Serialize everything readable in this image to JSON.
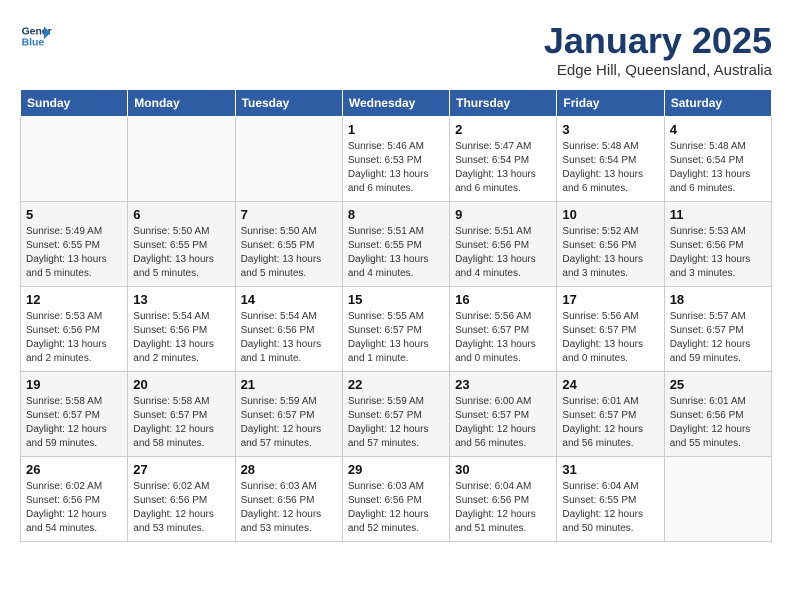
{
  "header": {
    "logo_line1": "General",
    "logo_line2": "Blue",
    "month": "January 2025",
    "location": "Edge Hill, Queensland, Australia"
  },
  "days_of_week": [
    "Sunday",
    "Monday",
    "Tuesday",
    "Wednesday",
    "Thursday",
    "Friday",
    "Saturday"
  ],
  "weeks": [
    [
      {
        "num": "",
        "info": ""
      },
      {
        "num": "",
        "info": ""
      },
      {
        "num": "",
        "info": ""
      },
      {
        "num": "1",
        "info": "Sunrise: 5:46 AM\nSunset: 6:53 PM\nDaylight: 13 hours\nand 6 minutes."
      },
      {
        "num": "2",
        "info": "Sunrise: 5:47 AM\nSunset: 6:54 PM\nDaylight: 13 hours\nand 6 minutes."
      },
      {
        "num": "3",
        "info": "Sunrise: 5:48 AM\nSunset: 6:54 PM\nDaylight: 13 hours\nand 6 minutes."
      },
      {
        "num": "4",
        "info": "Sunrise: 5:48 AM\nSunset: 6:54 PM\nDaylight: 13 hours\nand 6 minutes."
      }
    ],
    [
      {
        "num": "5",
        "info": "Sunrise: 5:49 AM\nSunset: 6:55 PM\nDaylight: 13 hours\nand 5 minutes."
      },
      {
        "num": "6",
        "info": "Sunrise: 5:50 AM\nSunset: 6:55 PM\nDaylight: 13 hours\nand 5 minutes."
      },
      {
        "num": "7",
        "info": "Sunrise: 5:50 AM\nSunset: 6:55 PM\nDaylight: 13 hours\nand 5 minutes."
      },
      {
        "num": "8",
        "info": "Sunrise: 5:51 AM\nSunset: 6:55 PM\nDaylight: 13 hours\nand 4 minutes."
      },
      {
        "num": "9",
        "info": "Sunrise: 5:51 AM\nSunset: 6:56 PM\nDaylight: 13 hours\nand 4 minutes."
      },
      {
        "num": "10",
        "info": "Sunrise: 5:52 AM\nSunset: 6:56 PM\nDaylight: 13 hours\nand 3 minutes."
      },
      {
        "num": "11",
        "info": "Sunrise: 5:53 AM\nSunset: 6:56 PM\nDaylight: 13 hours\nand 3 minutes."
      }
    ],
    [
      {
        "num": "12",
        "info": "Sunrise: 5:53 AM\nSunset: 6:56 PM\nDaylight: 13 hours\nand 2 minutes."
      },
      {
        "num": "13",
        "info": "Sunrise: 5:54 AM\nSunset: 6:56 PM\nDaylight: 13 hours\nand 2 minutes."
      },
      {
        "num": "14",
        "info": "Sunrise: 5:54 AM\nSunset: 6:56 PM\nDaylight: 13 hours\nand 1 minute."
      },
      {
        "num": "15",
        "info": "Sunrise: 5:55 AM\nSunset: 6:57 PM\nDaylight: 13 hours\nand 1 minute."
      },
      {
        "num": "16",
        "info": "Sunrise: 5:56 AM\nSunset: 6:57 PM\nDaylight: 13 hours\nand 0 minutes."
      },
      {
        "num": "17",
        "info": "Sunrise: 5:56 AM\nSunset: 6:57 PM\nDaylight: 13 hours\nand 0 minutes."
      },
      {
        "num": "18",
        "info": "Sunrise: 5:57 AM\nSunset: 6:57 PM\nDaylight: 12 hours\nand 59 minutes."
      }
    ],
    [
      {
        "num": "19",
        "info": "Sunrise: 5:58 AM\nSunset: 6:57 PM\nDaylight: 12 hours\nand 59 minutes."
      },
      {
        "num": "20",
        "info": "Sunrise: 5:58 AM\nSunset: 6:57 PM\nDaylight: 12 hours\nand 58 minutes."
      },
      {
        "num": "21",
        "info": "Sunrise: 5:59 AM\nSunset: 6:57 PM\nDaylight: 12 hours\nand 57 minutes."
      },
      {
        "num": "22",
        "info": "Sunrise: 5:59 AM\nSunset: 6:57 PM\nDaylight: 12 hours\nand 57 minutes."
      },
      {
        "num": "23",
        "info": "Sunrise: 6:00 AM\nSunset: 6:57 PM\nDaylight: 12 hours\nand 56 minutes."
      },
      {
        "num": "24",
        "info": "Sunrise: 6:01 AM\nSunset: 6:57 PM\nDaylight: 12 hours\nand 56 minutes."
      },
      {
        "num": "25",
        "info": "Sunrise: 6:01 AM\nSunset: 6:56 PM\nDaylight: 12 hours\nand 55 minutes."
      }
    ],
    [
      {
        "num": "26",
        "info": "Sunrise: 6:02 AM\nSunset: 6:56 PM\nDaylight: 12 hours\nand 54 minutes."
      },
      {
        "num": "27",
        "info": "Sunrise: 6:02 AM\nSunset: 6:56 PM\nDaylight: 12 hours\nand 53 minutes."
      },
      {
        "num": "28",
        "info": "Sunrise: 6:03 AM\nSunset: 6:56 PM\nDaylight: 12 hours\nand 53 minutes."
      },
      {
        "num": "29",
        "info": "Sunrise: 6:03 AM\nSunset: 6:56 PM\nDaylight: 12 hours\nand 52 minutes."
      },
      {
        "num": "30",
        "info": "Sunrise: 6:04 AM\nSunset: 6:56 PM\nDaylight: 12 hours\nand 51 minutes."
      },
      {
        "num": "31",
        "info": "Sunrise: 6:04 AM\nSunset: 6:55 PM\nDaylight: 12 hours\nand 50 minutes."
      },
      {
        "num": "",
        "info": ""
      }
    ]
  ]
}
